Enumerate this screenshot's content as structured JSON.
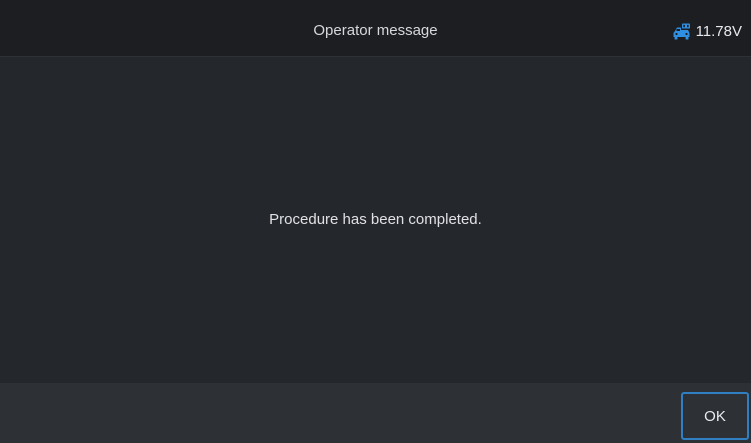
{
  "header": {
    "title": "Operator message",
    "voltage": {
      "icon": "car-battery-icon",
      "value": "11.78V",
      "icon_color": "#2f8fe0"
    }
  },
  "dialog": {
    "message": "Procedure has been completed."
  },
  "footer": {
    "ok_label": "OK",
    "ok_border_color": "#2f7fc2"
  }
}
